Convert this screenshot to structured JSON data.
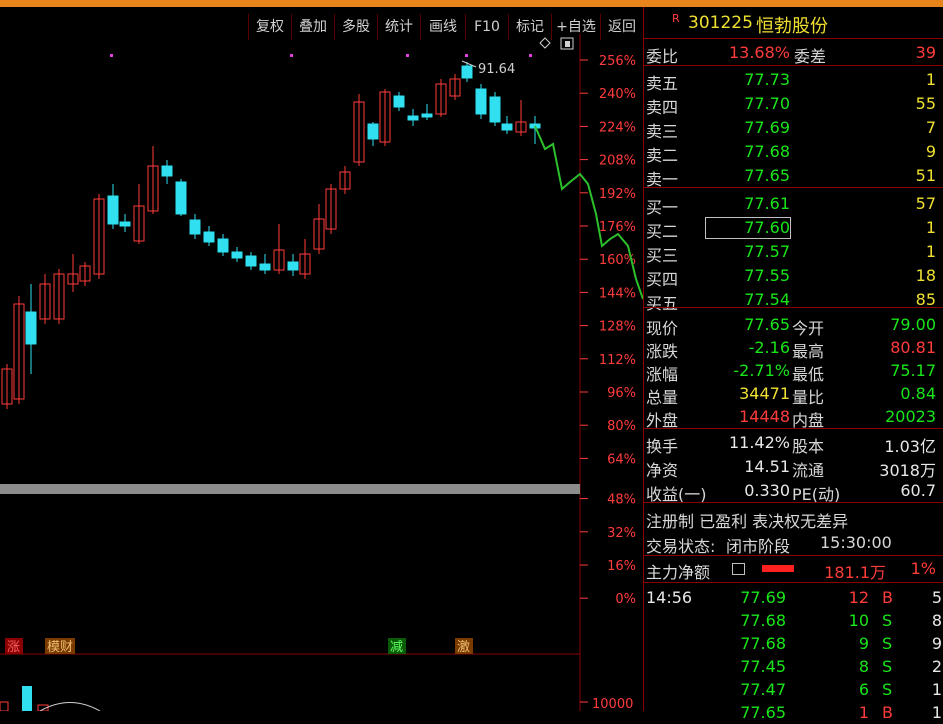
{
  "toolbar": {
    "buttons": [
      "复权",
      "叠加",
      "多股",
      "统计",
      "画线",
      "F10",
      "标记",
      "+自选",
      "返回"
    ]
  },
  "stock": {
    "badge": "R",
    "code": "301225",
    "name": "恒勃股份"
  },
  "axis": {
    "pct_labels": [
      "256%",
      "240%",
      "224%",
      "208%",
      "192%",
      "176%",
      "160%",
      "144%",
      "128%",
      "112%",
      "96%",
      "80%",
      "64%",
      "48%",
      "32%",
      "16%",
      "0%"
    ],
    "volume_label": "10000"
  },
  "chart_annotations": {
    "high_mark": "91.64",
    "tags": [
      "涨",
      "模财",
      "减",
      "激"
    ]
  },
  "ratio": {
    "label1": "委比",
    "value1": "13.68%",
    "label2": "委差",
    "value2": "39"
  },
  "asks": [
    {
      "label": "卖五",
      "price": "77.73",
      "vol": "1"
    },
    {
      "label": "卖四",
      "price": "77.70",
      "vol": "55"
    },
    {
      "label": "卖三",
      "price": "77.69",
      "vol": "7"
    },
    {
      "label": "卖二",
      "price": "77.68",
      "vol": "9"
    },
    {
      "label": "卖一",
      "price": "77.65",
      "vol": "51"
    }
  ],
  "bids": [
    {
      "label": "买一",
      "price": "77.61",
      "vol": "57"
    },
    {
      "label": "买二",
      "price": "77.60",
      "vol": "1"
    },
    {
      "label": "买三",
      "price": "77.57",
      "vol": "1"
    },
    {
      "label": "买四",
      "price": "77.55",
      "vol": "18"
    },
    {
      "label": "买五",
      "price": "77.54",
      "vol": "85"
    }
  ],
  "quote": [
    {
      "l1": "现价",
      "v1": "77.65",
      "c1": "green",
      "l2": "今开",
      "v2": "79.00",
      "c2": "green"
    },
    {
      "l1": "涨跌",
      "v1": "-2.16",
      "c1": "green",
      "l2": "最高",
      "v2": "80.81",
      "c2": "red"
    },
    {
      "l1": "涨幅",
      "v1": "-2.71%",
      "c1": "green",
      "l2": "最低",
      "v2": "75.17",
      "c2": "green"
    },
    {
      "l1": "总量",
      "v1": "34471",
      "c1": "yellow",
      "l2": "量比",
      "v2": "0.84",
      "c2": "green"
    },
    {
      "l1": "外盘",
      "v1": "14448",
      "c1": "red",
      "l2": "内盘",
      "v2": "20023",
      "c2": "green"
    }
  ],
  "fundamentals": [
    {
      "l1": "换手",
      "v1": "11.42%",
      "l2": "股本",
      "v2": "1.03亿"
    },
    {
      "l1": "净资",
      "v1": "14.51",
      "l2": "流通",
      "v2": "3018万"
    },
    {
      "l1": "收益(一)",
      "v1": "0.330",
      "l2": "PE(动)",
      "v2": "60.7"
    }
  ],
  "info": {
    "tags": "注册制 已盈利 表决权无差异",
    "status_label": "交易状态:",
    "status_value": "闭市阶段",
    "status_time": "15:30:00",
    "main_force_label": "主力净额",
    "main_force_value": "181.1万",
    "main_force_pct": "1%"
  },
  "ticks": {
    "time": "14:56",
    "rows": [
      {
        "price": "77.69",
        "vol": "12",
        "side": "B",
        "n": "5"
      },
      {
        "price": "77.68",
        "vol": "10",
        "side": "S",
        "n": "8"
      },
      {
        "price": "77.68",
        "vol": "9",
        "side": "S",
        "n": "9"
      },
      {
        "price": "77.45",
        "vol": "8",
        "side": "S",
        "n": "2"
      },
      {
        "price": "77.47",
        "vol": "6",
        "side": "S",
        "n": "1"
      },
      {
        "price": "77.65",
        "vol": "1",
        "side": "B",
        "n": "1"
      }
    ]
  },
  "colors": {
    "up": "#ff3c3c",
    "down": "#30e0f0",
    "bg": "#000000",
    "accent": "#e8841c"
  }
}
